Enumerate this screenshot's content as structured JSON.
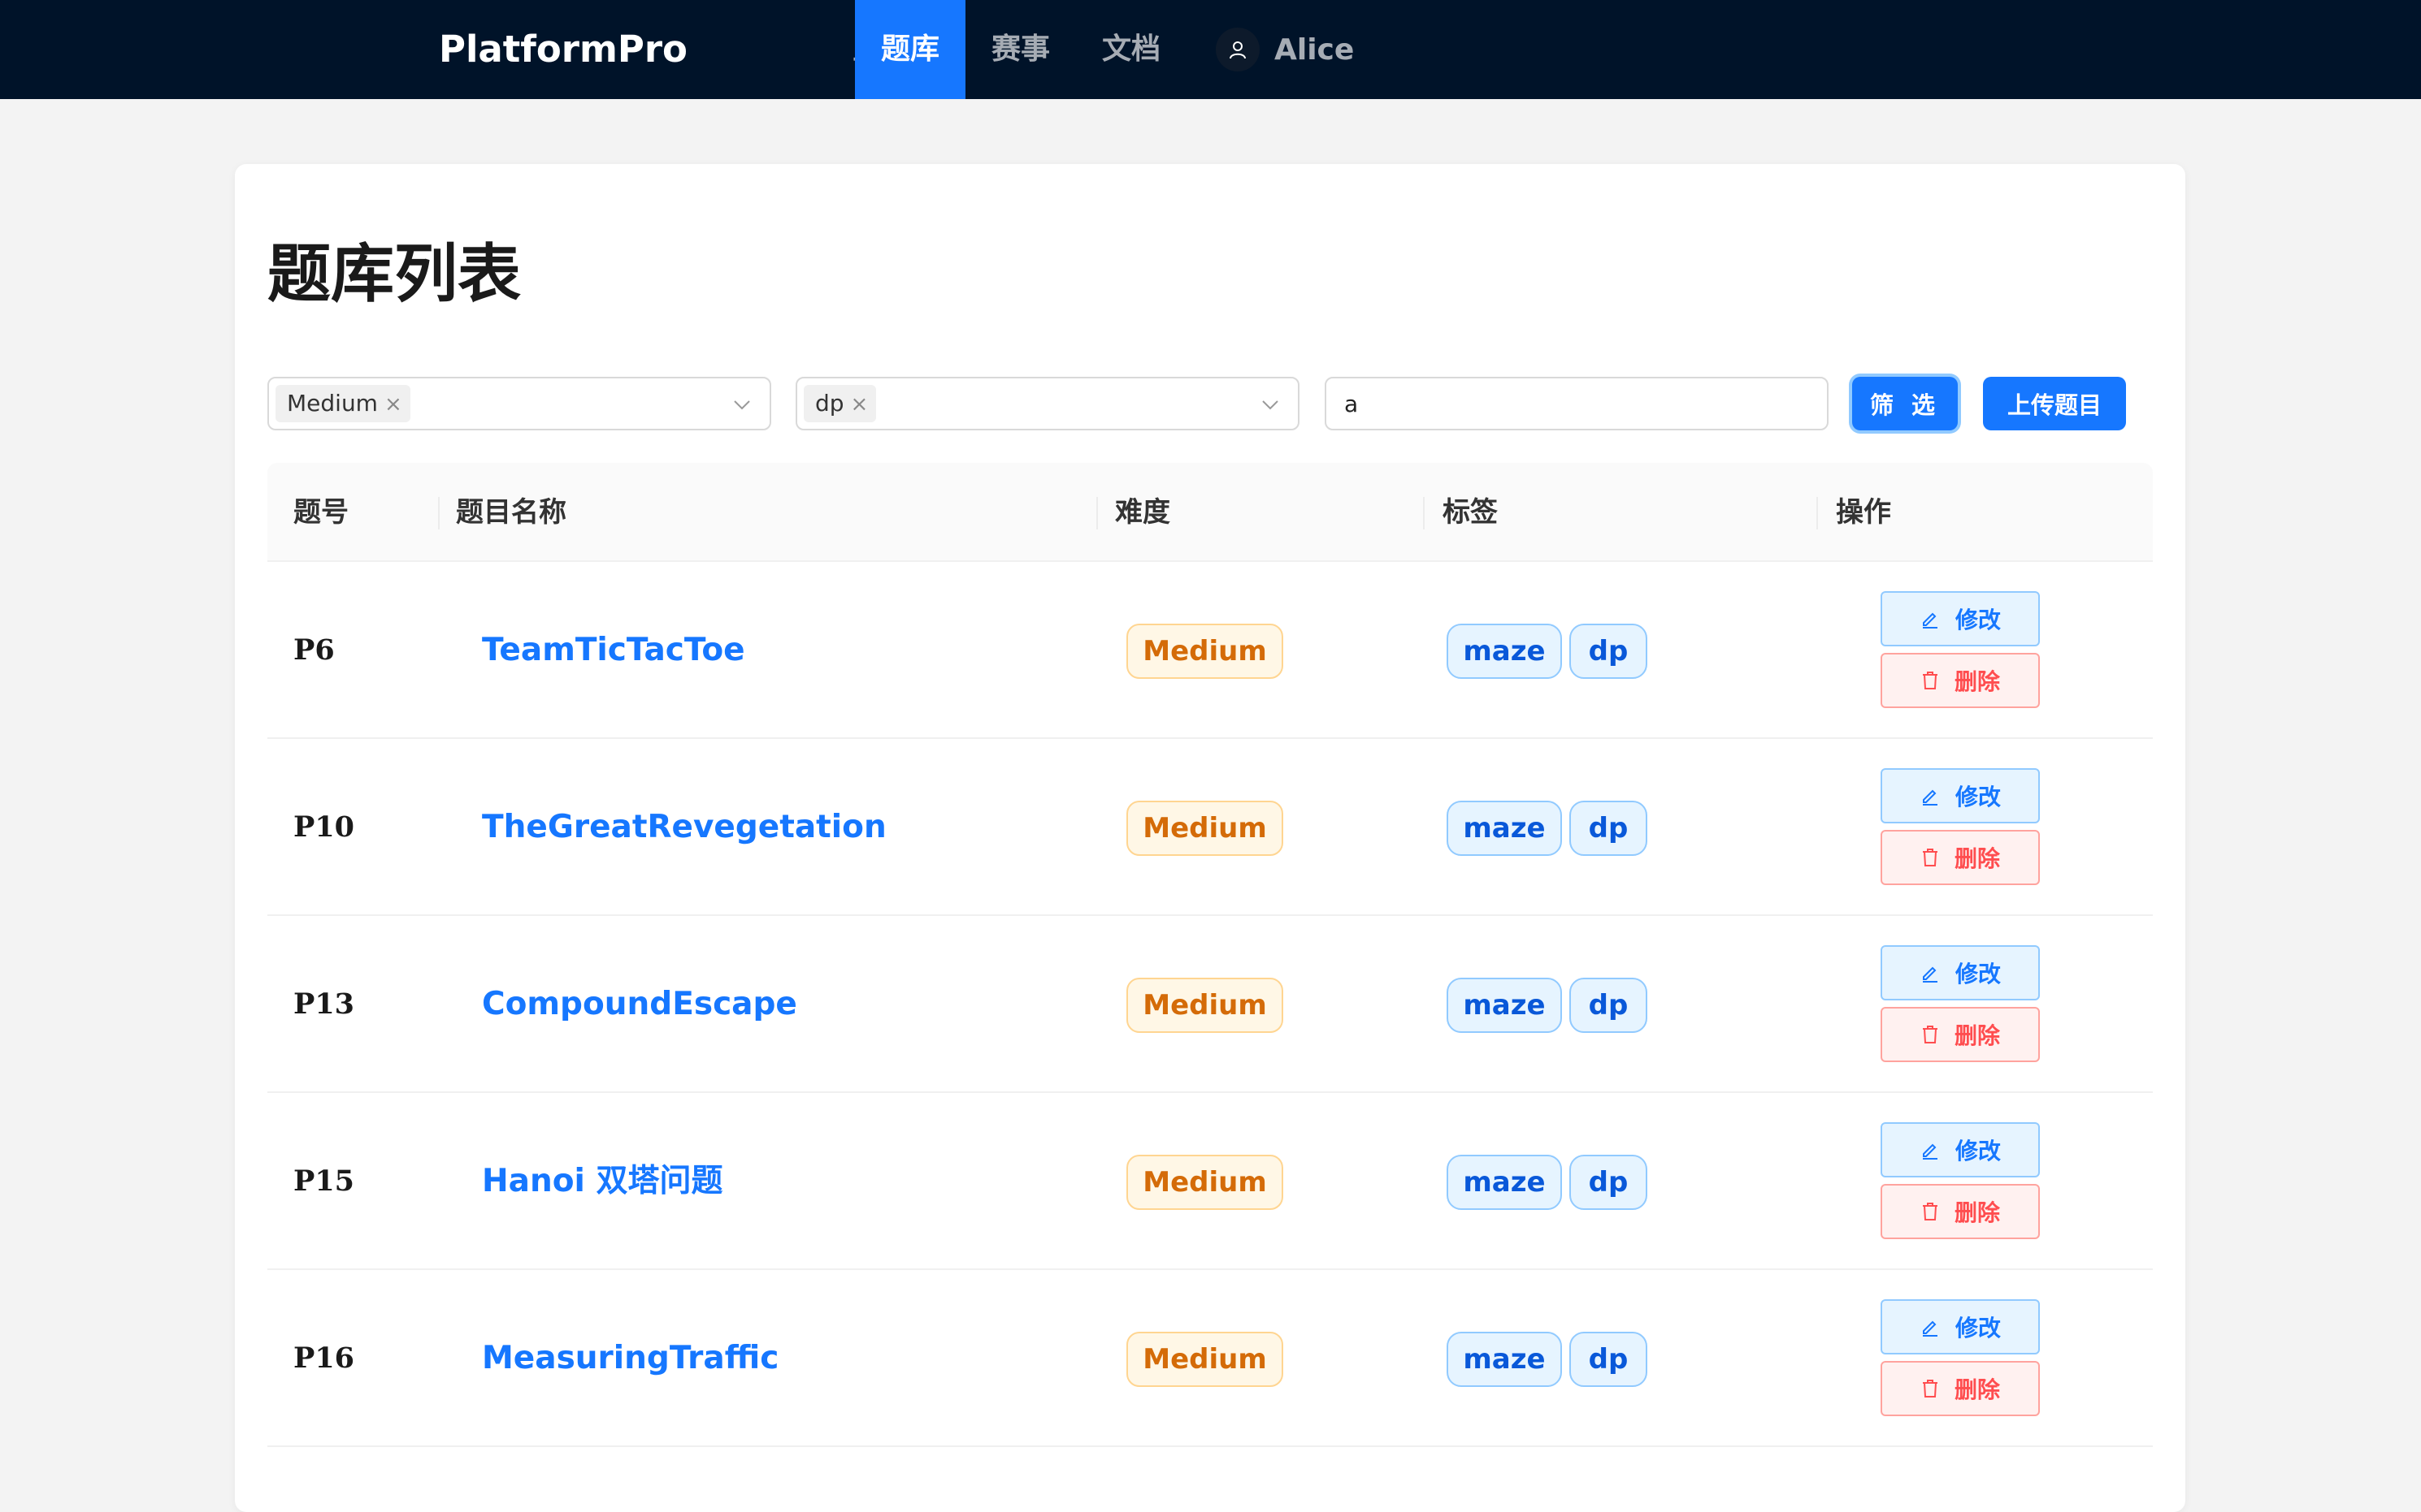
{
  "nav": {
    "brand": "PlatformPro",
    "items": [
      {
        "label": "主页",
        "active": false
      },
      {
        "label": "题库",
        "active": true
      },
      {
        "label": "赛事",
        "active": false
      },
      {
        "label": "文档",
        "active": false
      }
    ],
    "user": {
      "name": "Alice",
      "icon": "user-icon"
    }
  },
  "page": {
    "title": "题库列表"
  },
  "filters": {
    "difficulty": {
      "selected_tag": "Medium",
      "close_symbol": "×"
    },
    "tags": {
      "selected_tag": "dp",
      "close_symbol": "×"
    },
    "search": {
      "value": "a"
    },
    "filter_button": "筛 选",
    "upload_button": "上传题目"
  },
  "table": {
    "headers": {
      "id": "题号",
      "name": "题目名称",
      "difficulty": "难度",
      "tags": "标签",
      "actions": "操作"
    },
    "edit_label": "修改",
    "delete_label": "删除",
    "rows": [
      {
        "id": "P6",
        "name": "TeamTicTacToe",
        "difficulty": "Medium",
        "tags": [
          "maze",
          "dp"
        ]
      },
      {
        "id": "P10",
        "name": "TheGreatRevegetation",
        "difficulty": "Medium",
        "tags": [
          "maze",
          "dp"
        ]
      },
      {
        "id": "P13",
        "name": "CompoundEscape",
        "difficulty": "Medium",
        "tags": [
          "maze",
          "dp"
        ]
      },
      {
        "id": "P15",
        "name": "Hanoi 双塔问题",
        "difficulty": "Medium",
        "tags": [
          "maze",
          "dp"
        ]
      },
      {
        "id": "P16",
        "name": "MeasuringTraffic",
        "difficulty": "Medium",
        "tags": [
          "maze",
          "dp"
        ]
      }
    ]
  },
  "colors": {
    "nav_bg": "#001329",
    "accent": "#1677ff",
    "difficulty_medium": "#d46b08",
    "tag_text": "#0958d9",
    "danger": "#ff4d4f"
  }
}
